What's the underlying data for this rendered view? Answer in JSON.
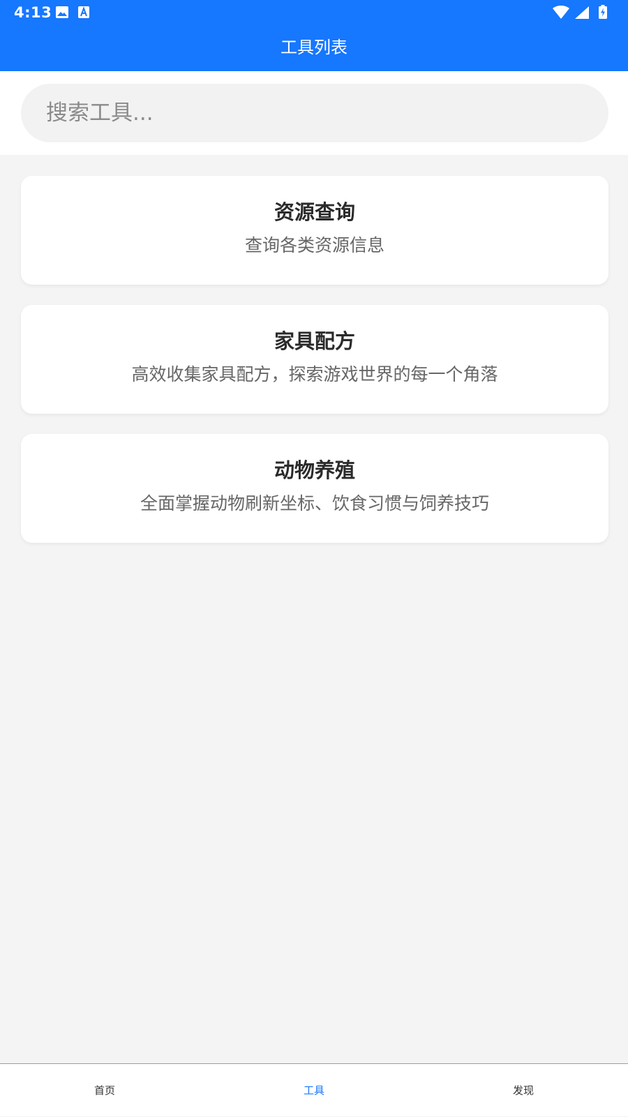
{
  "status_bar": {
    "time": "4:13",
    "icons_left": [
      "image-icon",
      "a-letter-icon"
    ],
    "icons_right": [
      "wifi-icon",
      "cell-signal-icon",
      "battery-charging-icon"
    ]
  },
  "header": {
    "title": "工具列表",
    "background_color": "#1677ff"
  },
  "search": {
    "placeholder": "搜索工具...",
    "value": ""
  },
  "tools": [
    {
      "title": "资源查询",
      "description": "查询各类资源信息"
    },
    {
      "title": "家具配方",
      "description": "高效收集家具配方，探索游戏世界的每一个角落"
    },
    {
      "title": "动物养殖",
      "description": "全面掌握动物刷新坐标、饮食习惯与饲养技巧"
    }
  ],
  "bottom_nav": {
    "items": [
      {
        "label": "首页"
      },
      {
        "label": "工具"
      },
      {
        "label": "发现"
      }
    ],
    "active": "工具",
    "active_color": "#1677ff"
  }
}
